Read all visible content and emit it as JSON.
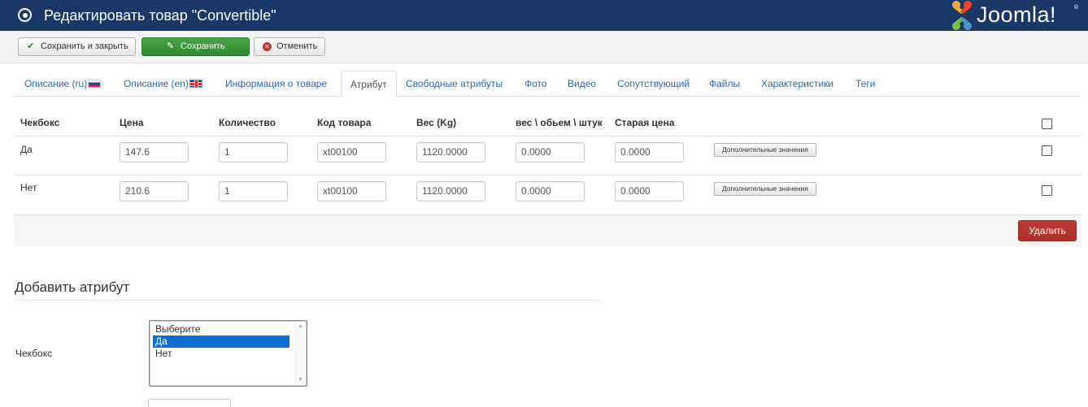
{
  "header": {
    "title": "Редактировать товар \"Convertible\"",
    "logo_text": "Joomla!",
    "logo_reg": "®",
    "bg_color": "#1a3867"
  },
  "toolbar": {
    "save_close_label": "Сохранить и закрыть",
    "save_label": "Сохранить",
    "cancel_label": "Отменить"
  },
  "tabs": [
    {
      "label": "Описание (ru)",
      "flag": "ru"
    },
    {
      "label": "Описание (en)",
      "flag": "en"
    },
    {
      "label": "Информация о товаре"
    },
    {
      "label": "Атрибут",
      "active": true
    },
    {
      "label": "Свободные атрибуты"
    },
    {
      "label": "Фото"
    },
    {
      "label": "Видео"
    },
    {
      "label": "Сопутствующий"
    },
    {
      "label": "Файлы"
    },
    {
      "label": "Характеристики"
    },
    {
      "label": "Теги"
    }
  ],
  "table": {
    "headers": [
      "Чекбокс",
      "Цена",
      "Количество",
      "Код товара",
      "Вес (Kg)",
      "вес \\ обьем \\ штук",
      "Старая цена"
    ],
    "extra_label": "Дополнительные значения",
    "rows": [
      {
        "label": "Да",
        "price": "147.6",
        "qty": "1",
        "code": "xt00100",
        "weight": "1120.0000",
        "volume": "0.0000",
        "old_price": "0.0000"
      },
      {
        "label": "Нет",
        "price": "210.6",
        "qty": "1",
        "code": "xt00100",
        "weight": "1120.0000",
        "volume": "0.0000",
        "old_price": "0.0000"
      }
    ],
    "delete_label": "Удалить"
  },
  "add_attribute": {
    "title": "Добавить атрибут",
    "field_label": "Чекбокс",
    "options": [
      "Выберите",
      "Да",
      "Нет"
    ],
    "selected": "Да"
  }
}
